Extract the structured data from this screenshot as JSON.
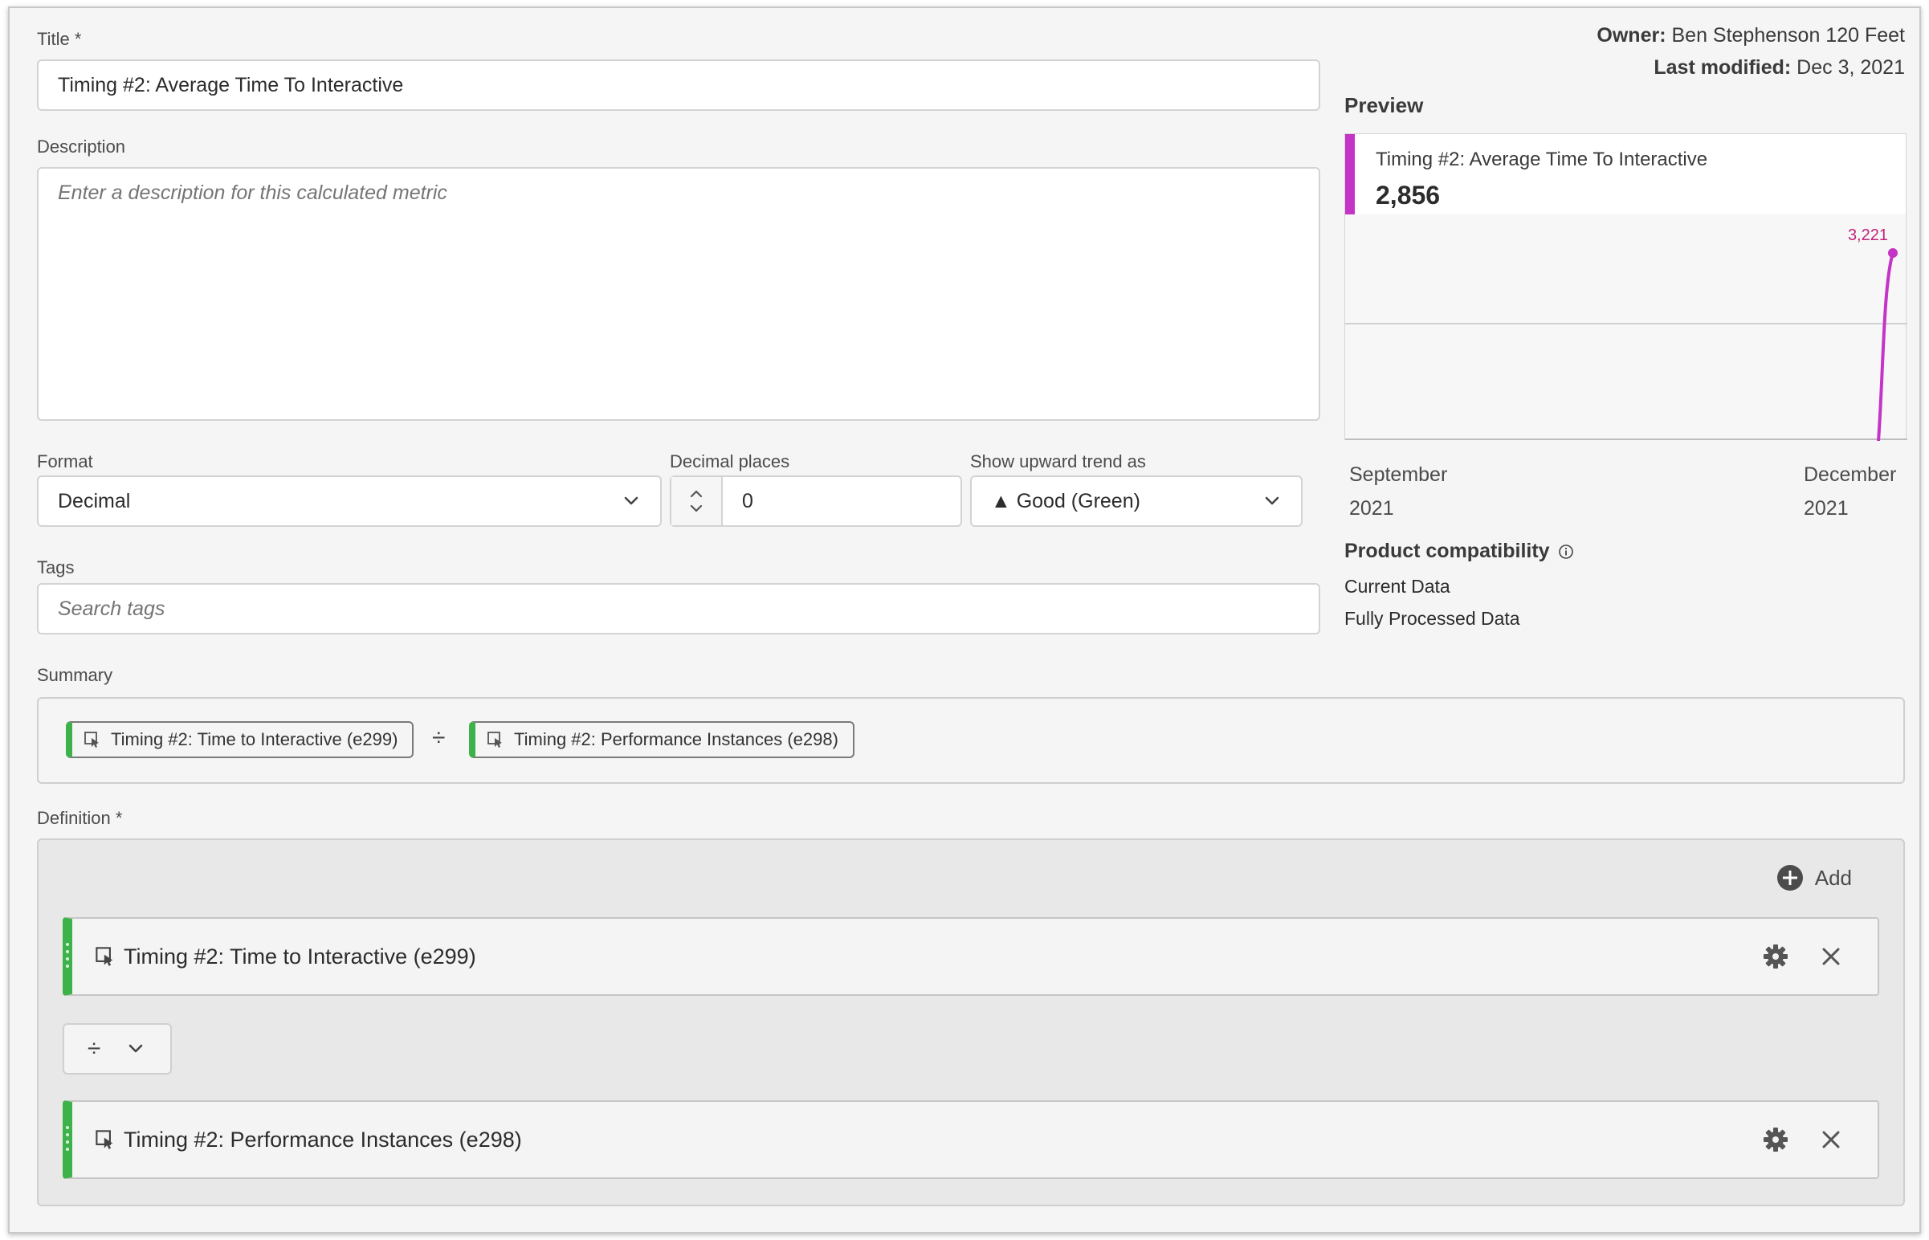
{
  "title": {
    "label": "Title",
    "required_mark": "*",
    "value": "Timing #2: Average Time To Interactive"
  },
  "description": {
    "label": "Description",
    "placeholder": "Enter a description for this calculated metric"
  },
  "owner": {
    "label": "Owner:",
    "value": "Ben Stephenson 120 Feet"
  },
  "last_modified": {
    "label": "Last modified:",
    "value": "Dec 3, 2021"
  },
  "preview": {
    "heading": "Preview",
    "metric_name": "Timing #2: Average Time To Interactive",
    "total": "2,856",
    "peak_label": "3,221",
    "accent_color": "#c434c6",
    "x_start_month": "September",
    "x_start_year": "2021",
    "x_end_month": "December",
    "x_end_year": "2021"
  },
  "chart_data": {
    "type": "line",
    "series": [
      {
        "values": [
          0,
          0,
          3221
        ]
      }
    ],
    "data_labels": [
      "3,221"
    ],
    "tick_labels": [
      "September 2021",
      "December 2021"
    ]
  },
  "product_compatibility": {
    "heading": "Product compatibility",
    "items": [
      "Current Data",
      "Fully Processed Data"
    ]
  },
  "format": {
    "label": "Format",
    "value": "Decimal"
  },
  "decimal_places": {
    "label": "Decimal places",
    "value": "0"
  },
  "upward_trend": {
    "label": "Show upward trend as",
    "value": "▲ Good (Green)"
  },
  "tags": {
    "label": "Tags",
    "placeholder": "Search tags"
  },
  "summary": {
    "label": "Summary",
    "left_metric": "Timing #2: Time to Interactive (e299)",
    "operator": "÷",
    "right_metric": "Timing #2: Performance Instances (e298)"
  },
  "definition": {
    "label": "Definition",
    "required_mark": "*",
    "add_label": "Add",
    "metric_1": "Timing #2: Time to Interactive (e299)",
    "operator": "÷",
    "metric_2": "Timing #2: Performance Instances (e298)",
    "accent_color": "#3db24b"
  }
}
